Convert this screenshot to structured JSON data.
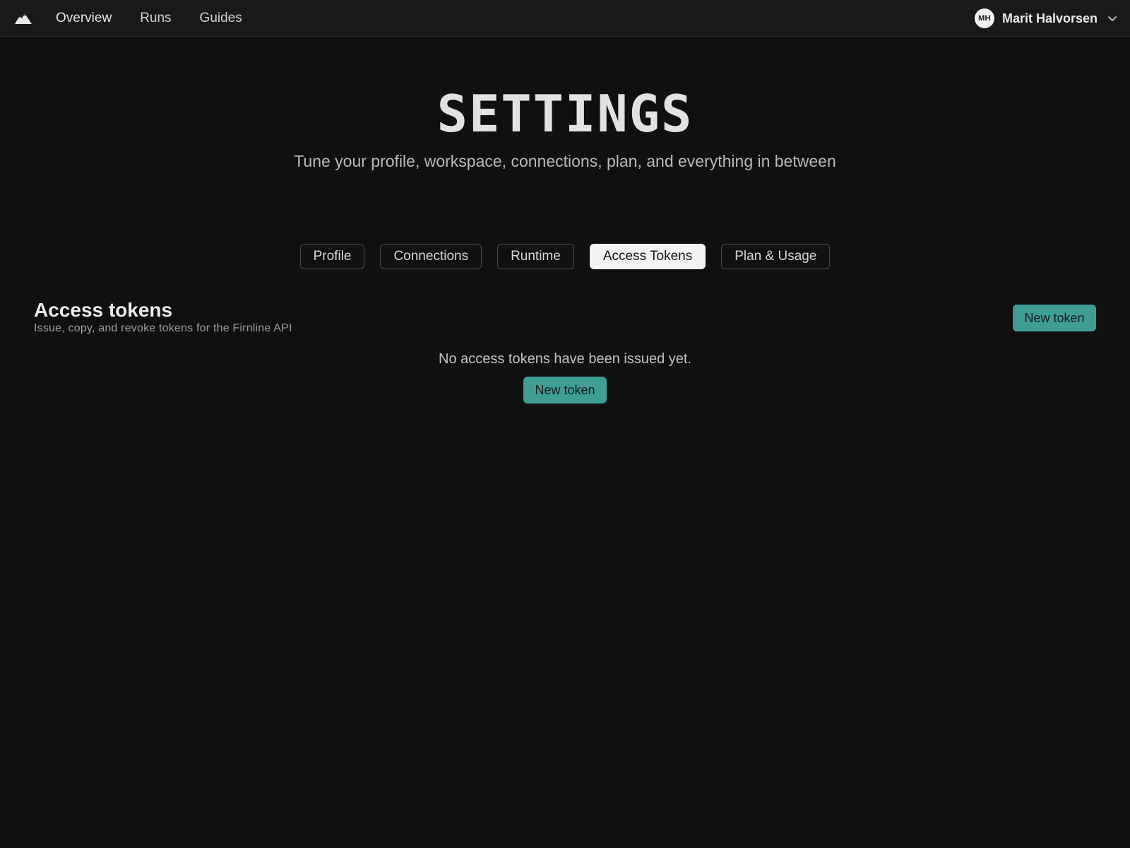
{
  "nav": {
    "logo": "mountain-logo",
    "items": [
      {
        "label": "Overview"
      },
      {
        "label": "Runs"
      },
      {
        "label": "Guides"
      }
    ]
  },
  "user": {
    "initials": "MH",
    "name": "Marit Halvorsen",
    "menu_icon": "chevron-down-icon"
  },
  "header": {
    "title": "SETTINGS",
    "subtitle": "Tune your profile, workspace, connections, plan, and everything in between"
  },
  "tabs": [
    {
      "label": "Profile"
    },
    {
      "label": "Connections"
    },
    {
      "label": "Runtime"
    },
    {
      "label": "Access Tokens",
      "active": true
    },
    {
      "label": "Plan & Usage"
    }
  ],
  "tokens_section": {
    "title": "Access tokens",
    "description": "Issue, copy, and revoke tokens for the Firnline API",
    "new_button_label": "New token",
    "empty_message": "No access tokens have been issued yet.",
    "empty_button_label": "New token"
  },
  "colors": {
    "background": "#0f1111",
    "topbar": "#181a1a",
    "accent": "#3f9d94",
    "active_tab": "#f1f2f2"
  }
}
